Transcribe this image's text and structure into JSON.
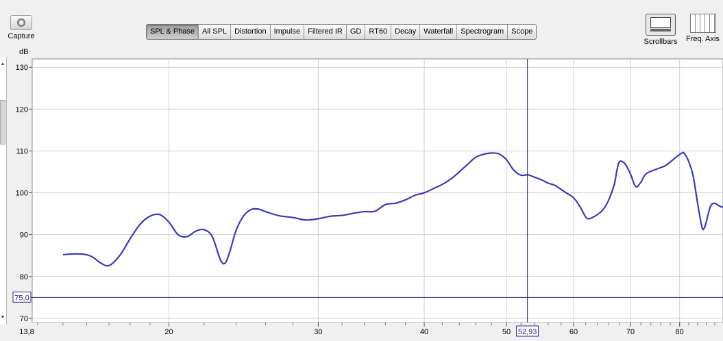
{
  "toolbar": {
    "capture_label": "Capture",
    "tabs": [
      "SPL & Phase",
      "All SPL",
      "Distortion",
      "Impulse",
      "Filtered IR",
      "GD",
      "RT60",
      "Decay",
      "Waterfall",
      "Spectrogram",
      "Scope"
    ],
    "active_tab": "SPL & Phase",
    "scrollbars_label": "Scrollbars",
    "freq_axis_label": "Freq. Axis"
  },
  "chart_data": {
    "type": "line",
    "ylabel": "dB",
    "ylim": [
      69,
      132
    ],
    "xlim": [
      13.8,
      90
    ],
    "x_scale": "log",
    "y_ticks": [
      70,
      80,
      90,
      100,
      110,
      120,
      130
    ],
    "x_ticks": [
      20,
      30,
      40,
      50,
      60,
      70,
      80
    ],
    "x_start_label": "13,8",
    "cursor": {
      "x": 52.93,
      "y": 75.0,
      "x_label": "52,93",
      "y_label": "75,0"
    },
    "series_color": "#3a3ab8",
    "cursor_color": "#2a2a8a",
    "series": [
      {
        "x": [
          15.0,
          15.5,
          16.0,
          16.3,
          16.6,
          17.0,
          17.5,
          18.0,
          18.5,
          19.0,
          19.5,
          20.0,
          20.5,
          21.0,
          21.5,
          22.0,
          22.5,
          23.0,
          23.3,
          23.6,
          24.0,
          24.5,
          25.0,
          25.5,
          26.0,
          27.0,
          28.0,
          29.0,
          30.0,
          31.0,
          32.0,
          33.0,
          34.0,
          35.0,
          36.0,
          37.0,
          38.0,
          39.0,
          40.0,
          41.0,
          42.0,
          43.0,
          44.0,
          45.0,
          46.0,
          47.0,
          48.0,
          49.0,
          50.0,
          51.0,
          52.0,
          53.0,
          54.0,
          55.0,
          56.0,
          57.0,
          58.0,
          59.0,
          60.0,
          61.0,
          62.0,
          62.5,
          63.0,
          64.0,
          65.0,
          66.0,
          67.0,
          67.5,
          68.0,
          69.0,
          70.0,
          71.0,
          72.0,
          73.0,
          75.0,
          77.0,
          79.0,
          80.5,
          81.0,
          82.0,
          83.0,
          84.0,
          85.0,
          85.5,
          86.0,
          87.0,
          88.0,
          89.0,
          90.0
        ],
        "y": [
          85.2,
          85.4,
          85.2,
          84.5,
          83.3,
          82.6,
          85.0,
          89.0,
          92.5,
          94.4,
          94.8,
          93.0,
          90.0,
          89.5,
          90.8,
          91.2,
          89.5,
          84.0,
          83.2,
          86.0,
          91.0,
          94.5,
          96.0,
          96.1,
          95.5,
          94.5,
          94.1,
          93.5,
          93.8,
          94.4,
          94.6,
          95.1,
          95.5,
          95.6,
          97.2,
          97.5,
          98.3,
          99.4,
          100.0,
          101.0,
          102.0,
          103.3,
          105.0,
          106.8,
          108.5,
          109.2,
          109.5,
          109.3,
          107.9,
          105.4,
          104.2,
          104.3,
          103.7,
          103.1,
          102.3,
          101.8,
          100.8,
          99.8,
          98.8,
          96.8,
          94.2,
          93.8,
          94.0,
          94.8,
          96.0,
          98.3,
          102.0,
          105.5,
          107.5,
          106.9,
          104.5,
          101.5,
          102.5,
          104.5,
          105.6,
          106.5,
          108.3,
          109.5,
          109.4,
          107.5,
          104.0,
          97.5,
          91.8,
          91.5,
          93.0,
          96.8,
          97.5,
          96.9,
          96.5
        ]
      }
    ],
    "grid": true
  }
}
